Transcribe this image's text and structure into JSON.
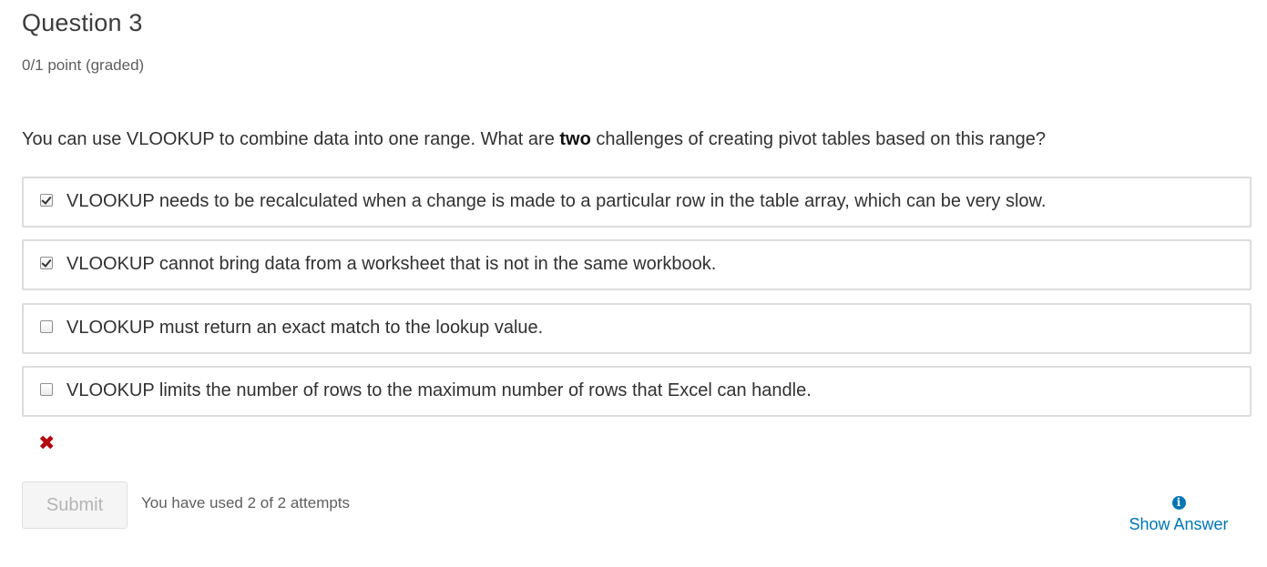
{
  "question": {
    "title": "Question 3",
    "score": "0/1 point (graded)",
    "prompt_before": "You can use VLOOKUP to combine data into one range. What are ",
    "prompt_bold": "two",
    "prompt_after": " challenges of creating pivot tables based on this range?"
  },
  "choices": [
    {
      "label": "VLOOKUP needs to be recalculated when a change is made to a particular row in the table array, which can be very slow.",
      "checked": true
    },
    {
      "label": "VLOOKUP cannot bring data from a worksheet that is not in the same workbook.",
      "checked": true
    },
    {
      "label": "VLOOKUP must return an exact match to the lookup value.",
      "checked": false
    },
    {
      "label": "VLOOKUP limits the number of rows to the maximum number of rows that Excel can handle.",
      "checked": false
    }
  ],
  "result": {
    "status": "incorrect",
    "icon": "close-icon",
    "icon_glyph": "✖",
    "color": "#b20610"
  },
  "actions": {
    "submit_label": "Submit",
    "attempts_text": "You have used 2 of 2 attempts",
    "show_answer_label": "Show Answer",
    "show_answer_icon": "info-icon",
    "info_glyph": "i",
    "link_color": "#0075b4"
  }
}
